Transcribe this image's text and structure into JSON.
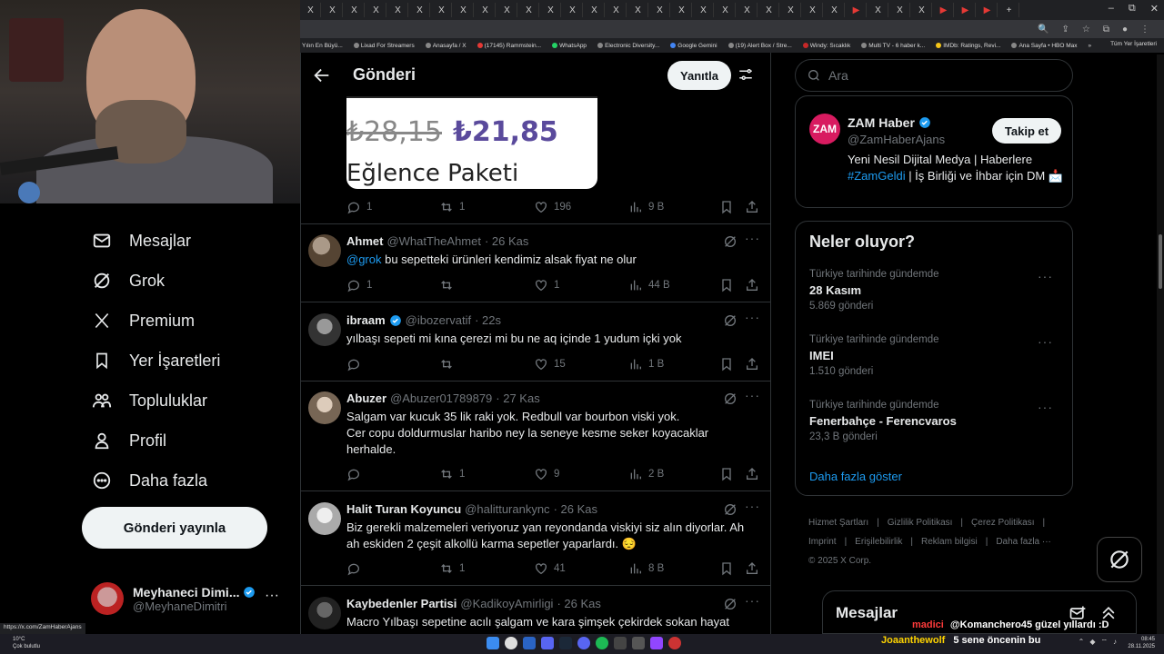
{
  "browser": {
    "tab_glyph": "X",
    "new_tab": "+",
    "window_controls": [
      "–",
      "⧉",
      "✕"
    ],
    "bookmarks": [
      "Yılın En Büyü...",
      "Lixad For Streamers",
      "Anasayfa / X",
      "(17145) Rammstein...",
      "WhatsApp",
      "Electronic Diversity...",
      "Google Gemini",
      "(19) Alert Box / Stre...",
      "Windy: Sıcaklık",
      "Multi TV - 6 haber k...",
      "IMDb: Ratings, Revi...",
      "Ana Sayfa • HBO Max"
    ],
    "bookmarks_more": "»",
    "all_bookmarks": "Tüm Yer İşaretleri",
    "status_url": "https://x.com/ZamHaberAjans"
  },
  "sidebar": {
    "items": [
      {
        "label": "Mesajlar",
        "icon": "envelope-icon"
      },
      {
        "label": "Grok",
        "icon": "grok-icon"
      },
      {
        "label": "Premium",
        "icon": "x-logo-icon"
      },
      {
        "label": "Yer İşaretleri",
        "icon": "bookmark-icon"
      },
      {
        "label": "Topluluklar",
        "icon": "people-icon"
      },
      {
        "label": "Profil",
        "icon": "person-icon"
      },
      {
        "label": "Daha fazla",
        "icon": "more-circle-icon"
      }
    ],
    "post_button": "Gönderi yayınla",
    "profile": {
      "name": "Meyhaneci Dimi...",
      "handle": "@MeyhaneDimitri",
      "more": "···"
    }
  },
  "header": {
    "title": "Gönderi",
    "reply_button": "Yanıtla"
  },
  "quoted_image": {
    "price_old": "₺28,15",
    "price_new": "₺21,85",
    "package": "Eğlence Paketi"
  },
  "first_actions": {
    "replies": "1",
    "reposts": "1",
    "likes": "196",
    "views": "9 B"
  },
  "tweets": [
    {
      "name": "Ahmet",
      "handle": "@WhatTheAhmet",
      "time": "· 26 Kas",
      "mention": "@grok",
      "text": " bu sepetteki ürünleri kendimiz alsak fiyat ne olur",
      "replies": "1",
      "reposts": "",
      "likes": "1",
      "views": "44 B",
      "verified": false
    },
    {
      "name": "ibraam",
      "handle": "@ibozervatif",
      "time": "· 22s",
      "mention": "",
      "text": "yılbaşı sepeti mi kına çerezi mi bu ne aq içinde 1 yudum içki yok",
      "replies": "",
      "reposts": "",
      "likes": "15",
      "views": "1 B",
      "verified": true
    },
    {
      "name": "Abuzer",
      "handle": "@Abuzer01789879",
      "time": "· 27 Kas",
      "mention": "",
      "text": "Salgam var kucuk 35 lik raki yok. Redbull var bourbon viski yok.\nCer copu doldurmuslar haribo ney la seneye kesme seker koyacaklar herhalde.",
      "replies": "",
      "reposts": "1",
      "likes": "9",
      "views": "2 B",
      "verified": false
    },
    {
      "name": "Halit Turan Koyuncu",
      "handle": "@halitturankync",
      "time": "· 26 Kas",
      "mention": "",
      "text": "Biz gerekli malzemeleri veriyoruz yan reyondanda viskiyi siz alın diyorlar. Ah ah eskiden 2 çeşit alkollü karma sepetler yaparlardı. 😔",
      "replies": "",
      "reposts": "1",
      "likes": "41",
      "views": "8 B",
      "verified": false
    },
    {
      "name": "Kaybedenler Partisi",
      "handle": "@KadikoyAmirligi",
      "time": "· 26 Kas",
      "mention": "",
      "text": "Macro Yılbaşı sepetine acılı şalgam ve kara şimşek çekirdek sokan hayat",
      "replies": "",
      "reposts": "",
      "likes": "",
      "views": "",
      "verified": false
    }
  ],
  "search": {
    "placeholder": "Ara"
  },
  "zam": {
    "logo": "ZAM",
    "name": "ZAM Haber",
    "handle": "@ZamHaberAjans",
    "follow": "Takip et",
    "bio_1": "Yeni Nesil Dijital Medya | Haberlere ",
    "bio_tag": "#ZamGeldi",
    "bio_2": " | İş Birliği ve İhbar için DM 📩"
  },
  "trends": {
    "title": "Neler oluyor?",
    "items": [
      {
        "context": "Türkiye tarihinde gündemde",
        "name": "28 Kasım",
        "count": "5.869 gönderi"
      },
      {
        "context": "Türkiye tarihinde gündemde",
        "name": "IMEI",
        "count": "1.510 gönderi"
      },
      {
        "context": "Türkiye tarihinde gündemde",
        "name": "Fenerbahçe - Ferencvaros",
        "count": "23,3 B gönderi"
      }
    ],
    "show_more": "Daha fazla göster"
  },
  "footer": [
    "Hizmet Şartları",
    "|",
    "Gizlilik Politikası",
    "|",
    "Çerez Politikası",
    "|",
    "Imprint",
    "|",
    "Erişilebilirlik",
    "|",
    "Reklam bilgisi",
    "|",
    "Daha fazla ···",
    "© 2025 X Corp."
  ],
  "messages": {
    "title": "Mesajlar"
  },
  "chat": [
    {
      "user": "madici",
      "text": "@Komanchero45 güzel yıllardı :D",
      "color": "#ff3b3b"
    },
    {
      "user": "Joaanthewolf",
      "text": "5 sene öncenin bu",
      "color": "#ffd400"
    }
  ],
  "taskbar": {
    "weather_temp": "10°C",
    "weather_text": "Çok bulutlu",
    "time": "08:45",
    "date": "28.11.2025"
  },
  "colors": {
    "accent": "#1d9bf0",
    "verified": "#1d9bf0",
    "background": "#000000"
  }
}
